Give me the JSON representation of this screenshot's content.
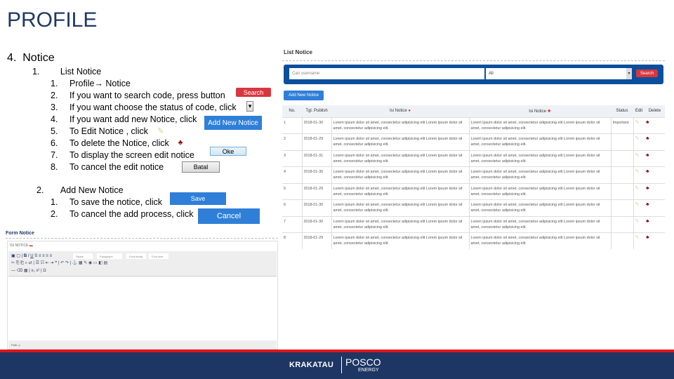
{
  "title": "PROFILE",
  "section": {
    "number": "4.",
    "label": "Notice"
  },
  "items": [
    {
      "number": "1.",
      "label": "List Notice",
      "steps": [
        {
          "n": "1.",
          "text": "Profile→ Notice"
        },
        {
          "n": "2.",
          "text": "If you want to search code, press button"
        },
        {
          "n": "3.",
          "text": "If you want choose the status of code, click"
        },
        {
          "n": "4.",
          "text": "If you want add new Notice, click"
        },
        {
          "n": "5.",
          "text": "To Edit Notice , click"
        },
        {
          "n": "6.",
          "text": "To delete the Notice, click"
        },
        {
          "n": "7.",
          "text": "To display the screen edit notice"
        },
        {
          "n": "8.",
          "text": "To cancel the edit notice"
        }
      ]
    },
    {
      "number": "2.",
      "label": "Add New Notice",
      "steps": [
        {
          "n": "1.",
          "text": "To save the notice, click"
        },
        {
          "n": "2.",
          "text": "To cancel the add process, click"
        }
      ]
    }
  ],
  "sample_buttons": {
    "search": "Search",
    "dropdown": "▾",
    "add": "Add New Notice",
    "edit": "✎",
    "delete": "♣",
    "oke": "Oke",
    "batal": "Batal",
    "save": "Save",
    "cancel": "Cancel"
  },
  "list_notice": {
    "heading": "List Notice",
    "search_placeholder": "Cari username",
    "status_select": "All",
    "search_button": "Search",
    "add_button": "Add New Notice",
    "columns": [
      "No.",
      "Tgl. Publish",
      "Isi Notice",
      "Isi Notice",
      "Status",
      "Edit",
      "Delete"
    ],
    "rows": [
      {
        "no": "1",
        "date": "2018-01-30",
        "id": "Lorem ipsum dolor sit amet, consectetur adipisicing elit Lorem ipsum dolor sit amet, consectetur adipisicing elit.",
        "en": "Lorem ipsum dolor sit amet, consectetur adipisicing elit Lorem ipsum dolor sit amet, consectetur adipisicing elit.",
        "status": "Important"
      },
      {
        "no": "2",
        "date": "2018-01-29",
        "id": "Lorem ipsum dolor sit amet, consectetur adipisicing elit Lorem ipsum dolor sit amet, consectetur adipisicing elit.",
        "en": "Lorem ipsum dolor sit amet, consectetur adipisicing elit Lorem ipsum dolor sit amet, consectetur adipisicing elit.",
        "status": ""
      },
      {
        "no": "3",
        "date": "2018-01-31",
        "id": "Lorem ipsum dolor sit amet, consectetur adipisicing elit Lorem ipsum dolor sit amet, consectetur adipisicing elit.",
        "en": "Lorem ipsum dolor sit amet, consectetur adipisicing elit Lorem ipsum dolor sit amet, consectetur adipisicing elit.",
        "status": ""
      },
      {
        "no": "4",
        "date": "2018-01-30",
        "id": "Lorem ipsum dolor sit amet, consectetur adipisicing elit Lorem ipsum dolor sit amet, consectetur adipisicing elit.",
        "en": "Lorem ipsum dolor sit amet, consectetur adipisicing elit Lorem ipsum dolor sit amet, consectetur adipisicing elit.",
        "status": ""
      },
      {
        "no": "5",
        "date": "2018-01-29",
        "id": "Lorem ipsum dolor sit amet, consectetur adipisicing elit Lorem ipsum dolor sit amet, consectetur adipisicing elit.",
        "en": "Lorem ipsum dolor sit amet, consectetur adipisicing elit Lorem ipsum dolor sit amet, consectetur adipisicing elit.",
        "status": ""
      },
      {
        "no": "6",
        "date": "2018-01-30",
        "id": "Lorem ipsum dolor sit amet, consectetur adipisicing elit Lorem ipsum dolor sit amet, consectetur adipisicing elit.",
        "en": "Lorem ipsum dolor sit amet, consectetur adipisicing elit Lorem ipsum dolor sit amet, consectetur adipisicing elit.",
        "status": ""
      },
      {
        "no": "7",
        "date": "2018-01-30",
        "id": "Lorem ipsum dolor sit amet, consectetur adipisicing elit Lorem ipsum dolor sit amet, consectetur adipisicing elit.",
        "en": "Lorem ipsum dolor sit amet, consectetur adipisicing elit Lorem ipsum dolor sit amet, consectetur adipisicing elit.",
        "status": ""
      },
      {
        "no": "8",
        "date": "2018-01-29",
        "id": "Lorem ipsum dolor sit amet, consectetur adipisicing elit Lorem ipsum dolor sit amet, consectetur adipisicing elit.",
        "en": "Lorem ipsum dolor sit amet, consectetur adipisicing elit Lorem ipsum dolor sit amet, consectetur adipisicing elit.",
        "status": ""
      }
    ]
  },
  "form_notice": {
    "heading": "Form Notice",
    "field_label": "ISI NOTICE",
    "toolbar": {
      "styles": "Styles",
      "format": "Paragraph",
      "font": "Font family",
      "size": "Font size"
    },
    "status_path": "Path: p"
  },
  "footer": {
    "logo_left": "KRAKATAU",
    "logo_right": "POSCO",
    "logo_sub": "ENERGY"
  },
  "colors": {
    "title": "#1f3864",
    "accent_blue": "#2f7fd8",
    "search_red": "#d9363e",
    "footer_bg": "#1d3663",
    "footer_line": "#e0141b"
  }
}
